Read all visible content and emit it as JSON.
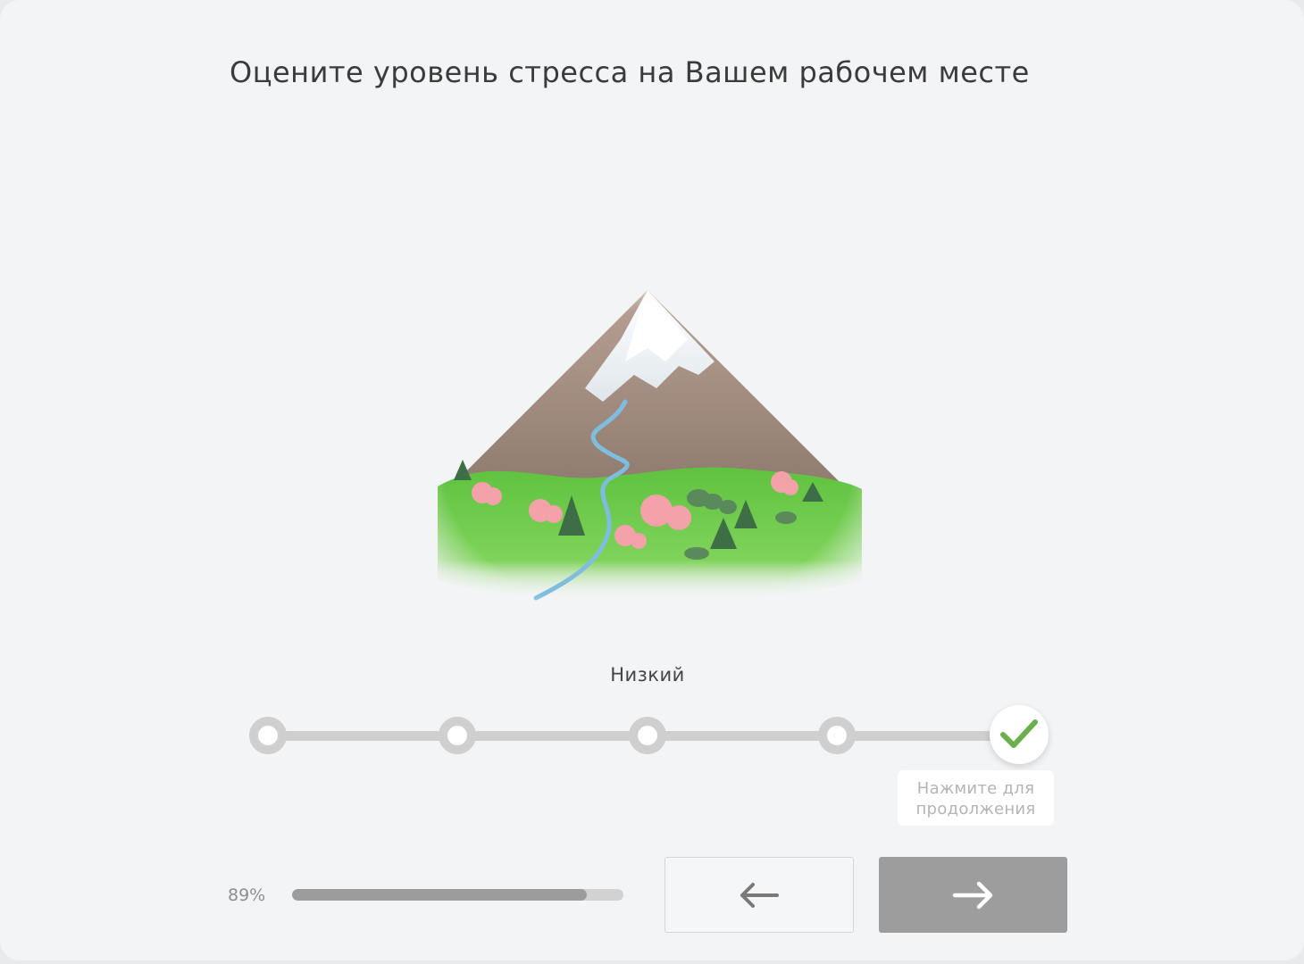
{
  "question": {
    "title": "Оцените уровень стресса на Вашем рабочем месте"
  },
  "illustration": {
    "icon": "mountain-landscape-illustration"
  },
  "scale": {
    "selected_label": "Низкий",
    "options_count": 5,
    "selected_index": 5,
    "selected_icon": "checkmark-icon",
    "check_color": "#6ab04c",
    "track_color": "#cfcfcf"
  },
  "hint": {
    "line1": "Нажмите для",
    "line2": "продолжения"
  },
  "progress": {
    "label": "89%",
    "value": 0.89
  },
  "navigation": {
    "prev_icon": "arrow-left-icon",
    "next_icon": "arrow-right-icon",
    "next_color": "#9d9d9d"
  }
}
